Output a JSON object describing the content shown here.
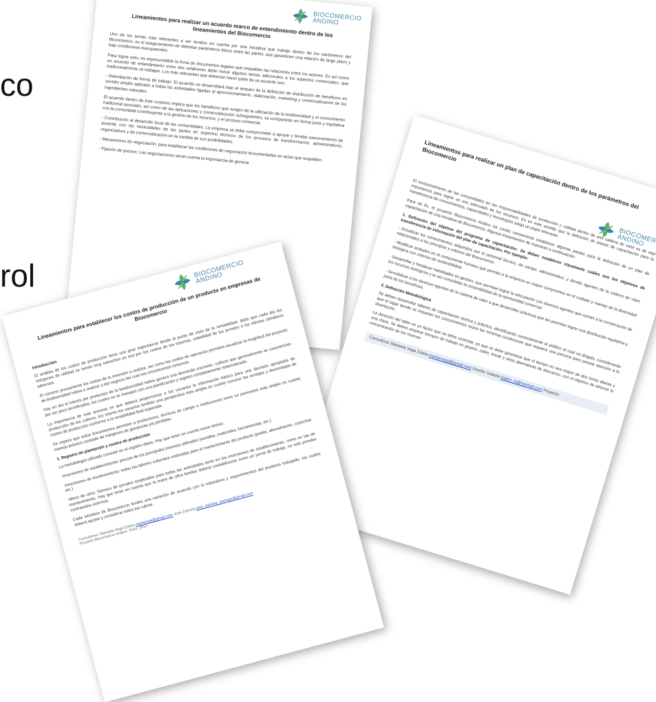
{
  "edge_fragments": [
    "co",
    "rol"
  ],
  "logo": {
    "line1": "BIOCOMERCIO",
    "line2": "ANDINO"
  },
  "doc_top": {
    "title": "Lineamientos para realizar un acuerdo marco de entendimiento dentro de los lineamientos del Biocomercio",
    "paragraphs": [
      "Uno de los temas más relevantes a ser tenidos en cuenta por una iniciativa que trabaje dentro de los parámetros del Biocomercio, es el aseguramiento de delimitar parámetros éticos entre las partes, que garanticen una relación de largo plazo y bajo condiciones transparentes.",
      "Para lograr esto, es imprescindible la firma de documentos legales que respalden las relaciones entre los actores. Es así como un acuerdo de entendimiento entre dos eslabones debe incluir algunos temas adicionales a los aspectos comerciales, que tradicionalmente se trabajan. Los más relevantes que deberían hacer parte de un acuerdo son:",
      "- Delimitación de forma de trabajo: El acuerdo se desarrollará bajo el amparo de la definición de distribución de beneficios en sentido amplio aplicado a todas las actividades ligadas al aprovisionamiento, elaboración, marketing y comercialización de los ingredientes naturales.",
      "El acuerdo dentro de éste contexto implica que los beneficios que surgen de la utilización de la biodiversidad y el conocimiento tradicional asociado, así como de las aplicaciones y comercialización subsiguientes, se compartirán en forma justa y equitativa con la comunidad contribuyente a la gestión de los recursos, y el proceso comercial.",
      "- Contribución al desarrollo local de las comunidades: La empresa se debe comprometer a apoyar y brindar asesoramiento de acuerdo con las necesidades de las partes en aspectos técnicos de los procesos de transformación, administrativos, organizativos y de comercialización en la medida de sus posibilidades.",
      "- Mecanismos de negociación: para establecer las condiciones de negociación documentadas en actas que respalden",
      "- Fijación de precios: Las negociaciones serán cuenta la importancia de generar"
    ]
  },
  "doc_right": {
    "title": "Lineamientos para realizar un plan de capacitación dentro de los parámetros del Biocomercio",
    "paragraphs": [
      "El involucramiento de las comunidades en las responsabilidades de producción y calidad dentro de una cadena de valor es de vital importancia para lograr un uso adecuado de los recursos. Es en este sentido que la definición de planes de capacitación para la transferencia de conocimientos, capacidades y tecnologías juega un papel relevante.",
      "Para tal fin, el proyecto Biocomercio Andino ha creído conveniente establecer algunas pautas para la definición de un plan de capacitación de una iniciativa de Biocomercio. Algunos lineamientos de muestran a continuación:",
      "1. Definición del objetivo del programa de capacitación: Se deben establecer claramente cuáles son los objetivos de transferencia de información del plan de capacitación. Por ejemplo:",
      "- Actualizar los conocimientos adquiridos por el personal técnico, de campo, administrativo, y demás agentes de la cadena de valor, relacionados a los principios y criterios del Biocomercio.",
      "- Modificar actitudes en el componente humano que permita a la empresa un mayor compromiso en el cuidado y manejo de la diversidad biológica con criterios de sostenibilidad.",
      "- Desarrollar y fortalecer habilidades en gestión, que permitan lograr la articulación con diversos agentes que suman a la conservación de los recursos biológicos y la vez consolidan la sostenibilidad de la oportunidad comercial.",
      "- Sensibilizar a los diversos agentes de la cadena de valor a que desarrollen prácticas que les permitan lograr una distribución equitativa y justa de los beneficios.",
      "2. Definición Metodológica",
      "Se deben desarrollar talleres de capacitación teórica y práctica, identificando correctamente el público al cual va dirigido, considerando que el lugar donde se impartan los conocimientos reúna las mínimas condiciones que requiere una persona para prestar atención a la disertación.",
      "La duración del taller es un factor que se debe controlar, ya que se debe garantizar que el tiempo no sea mayor de dos horas diarias y una clase. Se deben emplear tiempos de trabajo en grupos, cafés, break y otras alternativas de descanso, con el objetivo de reforzar la concentración de los mismos."
    ],
    "footer_text": "Consultora: Marisela Vega Zuleta",
    "footer_email": "marlasvega@gmail.com",
    "footer_text2": "Diseño: Isabela",
    "footer_email2": "isabm_m@hotmail.com",
    "footer_text3": "Proyecto"
  },
  "doc_front": {
    "title": "Lineamientos para establecer los costos de producción de un producto en empresas de Biocomercio",
    "intro_heading": "Introducción",
    "paragraphs": [
      "El análisis de los costos de producción tiene una gran importancia desde el punto de vista de la rentabilidad, dado que cada día los márgenes de utilidad se toman muy estrechos ya sea por los costos de los insumos, volatilidad de los jornales o los efectos climáticos adversos.",
      "El conocer previamente los costos de la inversión a realizar, así como los costos de operación permitirá visualizar la magnitud del proyecto de biodiversidad nativa a realizar o del negocio del cual nos encontramos inmersos.",
      "Hoy en día el interés por productos de la biodiversidad nativa genera una demanda creciente, cultivos que generalmente se caracterizan por ser poco tecnificados, los cuales no se manejan con una planificación y registro completamente sistematizado.",
      "La importancia de este proceso es que deberá proporcionar a los usuarios la información básica para una decisión apropiada de producción de los cultivos. Así mismo los usuarios tendrán una perspectiva más amplia en cuanto conocer las ventajas y desventajas de costos de producción conforme a la rentabilidad final esperada.",
      "Se espera que estos lineamientos permitan a productores, técnicos de campo e instituciones tener un panorama más amplio en cuanto manejo práctico contable de márgenes de ganancias y/o pérdidas."
    ],
    "section1_heading": "1. Registro de plantación y costos de producción",
    "section1_paragraphs": [
      "La metodología utilizada consiste en el registro datos. Hay que tener en cuenta varios temas:",
      "-Inversiones de establecimiento: precios de los principales insumos utilizados (semillas, materiales, herramientas, etc.)",
      "-Inversiones de mantenimiento: todas las labores culturales realizadas para el mantenimiento del producto (podas, abonamiento, cosechas etc.)",
      "-Mano de obra: Número de jornales empleados para todas las actividades tanto en las inversiones de establecimiento, como en las de mantenimiento. Hay que tener en cuenta que la mano de obra familiar deberá contabilizarse como un jornal de trabajo, no solo jornales contratados externos.",
      "Cada iniciativa de Biocomercio tendrá una variación de acuerdo con la naturaleza y requerimientos del producto trabajado, los cuales deberá ajustar y considerar todos los rubros."
    ],
    "footer_text": "Consultores: Marisela Vega Zuleta",
    "footer_email": "marlavega@gmail.com",
    "footer_text2": "José Zamora",
    "footer_email2": "jose_zamora_rastrago@gmail.com",
    "footer_text3": "Proyecto Biocomercio Andino. Perú, 2013"
  },
  "colors": {
    "logo_teal": "#3a87a6",
    "logo_green": "#5fae6b",
    "link_blue": "#2a4fc0"
  }
}
